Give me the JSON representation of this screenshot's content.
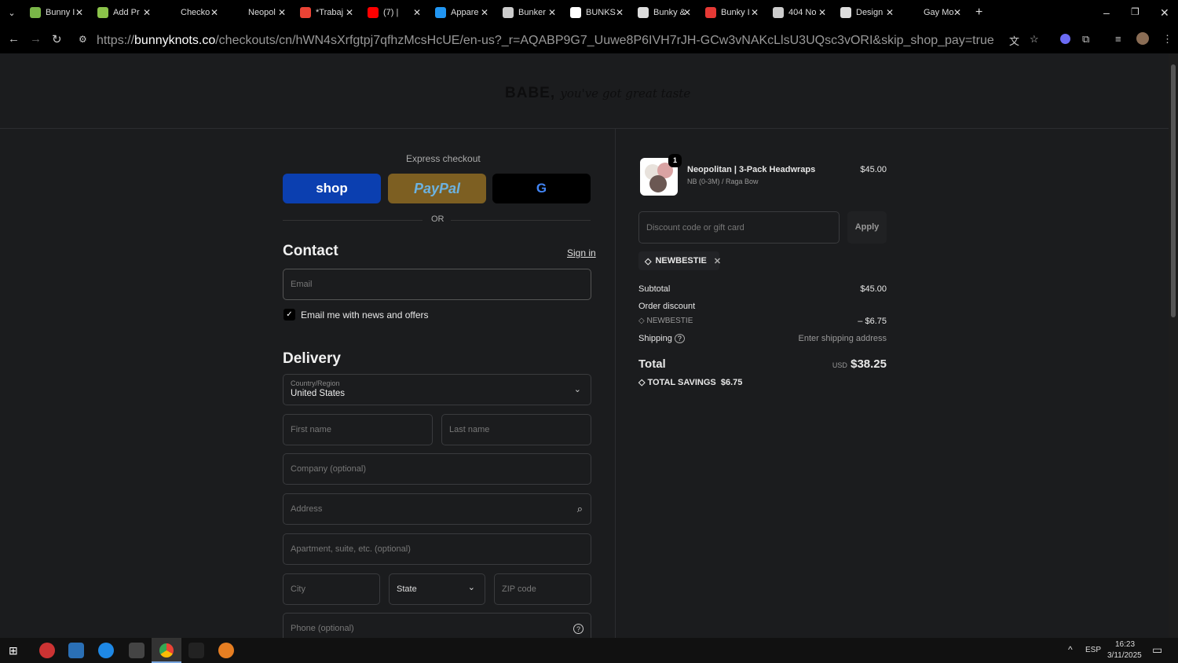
{
  "browser": {
    "tabs": [
      {
        "title": "Bunny I",
        "color": "#7ab648"
      },
      {
        "title": "Add Pr",
        "color": "#8bc34a"
      },
      {
        "title": "Checko",
        "color": "#000"
      },
      {
        "title": "Neopol",
        "color": "#000"
      },
      {
        "title": "*Trabaj",
        "color": "#ea4335"
      },
      {
        "title": "(7) |",
        "color": "#ff0000"
      },
      {
        "title": "Appare",
        "color": "#2196f3"
      },
      {
        "title": "Bunker",
        "color": "#ccc"
      },
      {
        "title": "BUNKS",
        "color": "#fff"
      },
      {
        "title": "Bunky &",
        "color": "#ddd"
      },
      {
        "title": "Bunky I",
        "color": "#e53935"
      },
      {
        "title": "404 No",
        "color": "#ccc"
      },
      {
        "title": "Design",
        "color": "#ddd"
      },
      {
        "title": "Gay Mo",
        "color": "#000"
      }
    ],
    "url_prefix": "https://",
    "url_domain": "bunnyknots.co",
    "url_rest": "/checkouts/cn/hWN4sXrfgtpj7qfhzMcsHcUE/en-us?_r=AQABP9G7_Uuwe8P6IVH7rJH-GCw3vNAKcLlsU3UQsc3vORI&skip_shop_pay=true"
  },
  "logo": {
    "bold": "BABE,",
    "script": "you've got great taste"
  },
  "express": {
    "title": "Express checkout",
    "shop": "shop",
    "paypal": "PayPal",
    "google": "G",
    "or": "OR"
  },
  "contact": {
    "title": "Contact",
    "sign_in": "Sign in",
    "email_placeholder": "Email",
    "newsletter": "Email me with news and offers",
    "newsletter_checked": true
  },
  "delivery": {
    "title": "Delivery",
    "country_label": "Country/Region",
    "country": "United States",
    "first_name": "First name",
    "last_name": "Last name",
    "company": "Company (optional)",
    "address": "Address",
    "apartment": "Apartment, suite, etc. (optional)",
    "city": "City",
    "state": "State",
    "zip": "ZIP code",
    "phone": "Phone (optional)"
  },
  "summary": {
    "item": {
      "name": "Neopolitan | 3-Pack Headwraps",
      "variant": "NB (0-3M) / Raga Bow",
      "price": "$45.00",
      "qty": "1"
    },
    "discount_placeholder": "Discount code or gift card",
    "apply": "Apply",
    "code": "NEWBESTIE",
    "subtotal_label": "Subtotal",
    "subtotal": "$45.00",
    "order_discount_label": "Order discount",
    "discount_code": "NEWBESTIE",
    "discount": "– $6.75",
    "shipping_label": "Shipping",
    "shipping": "Enter shipping address",
    "total_label": "Total",
    "currency": "USD",
    "total": "$38.25",
    "savings_label": "TOTAL SAVINGS",
    "savings": "$6.75"
  },
  "taskbar": {
    "lang": "ESP",
    "time": "16:23",
    "date": "3/11/2025"
  }
}
